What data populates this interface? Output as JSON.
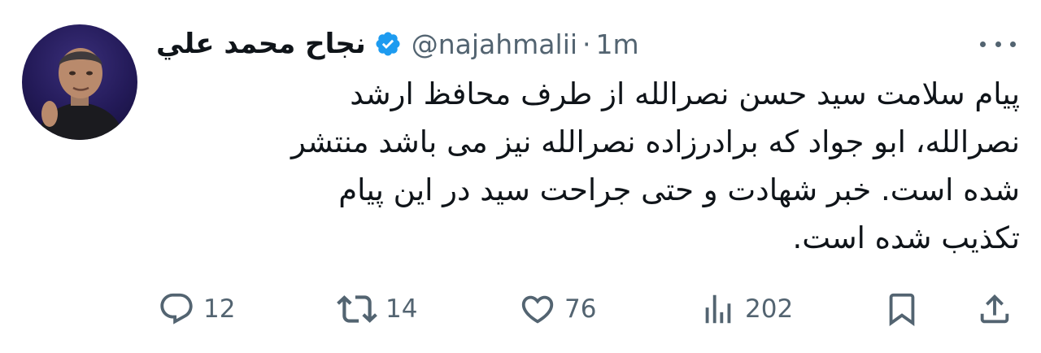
{
  "author": {
    "display_name": "نجاح محمد علي",
    "handle": "@najahmalii",
    "separator": "·",
    "time": "1m",
    "verified_icon": "verified-badge-icon",
    "avatar_icon": "profile-avatar"
  },
  "tweet": {
    "lines": [
      "پیام سلامت سید حسن نصرالله از طرف محافظ ارشد",
      "نصرالله، ابو جواد که برادرزاده نصرالله نیز می باشد منتشر",
      "شده است. خبر شهادت و حتی جراحت سید در این پیام",
      "تکذیب شده است."
    ]
  },
  "actions": {
    "reply": {
      "icon": "reply-icon",
      "count": "12"
    },
    "retweet": {
      "icon": "retweet-icon",
      "count": "14"
    },
    "like": {
      "icon": "heart-icon",
      "count": "76"
    },
    "views": {
      "icon": "views-icon",
      "count": "202"
    },
    "bookmark": {
      "icon": "bookmark-icon"
    },
    "share": {
      "icon": "share-icon"
    }
  },
  "colors": {
    "text": "#0f1419",
    "secondary": "#536471",
    "verified": "#1d9bf0"
  }
}
